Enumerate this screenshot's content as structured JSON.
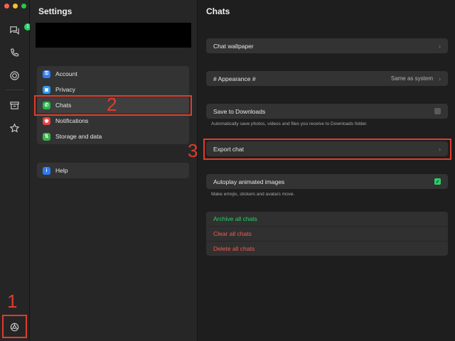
{
  "window": {
    "traffic_lights": [
      {
        "name": "close",
        "color": "#fe5f57"
      },
      {
        "name": "minimize",
        "color": "#febc2e"
      },
      {
        "name": "zoom",
        "color": "#28c840"
      }
    ]
  },
  "rail": {
    "chats_badge": "1",
    "badge_color": "#25d366",
    "icons": [
      "chats-icon",
      "calls-icon",
      "status-icon",
      "archive-icon",
      "starred-icon",
      "settings-icon"
    ]
  },
  "settings": {
    "title": "Settings",
    "items": [
      {
        "label": "Account",
        "icon": "key-icon",
        "color": "#2f7bf5",
        "glyph": "⚿"
      },
      {
        "label": "Privacy",
        "icon": "lock-icon",
        "color": "#2f9bf5",
        "glyph": "🔒"
      },
      {
        "label": "Chats",
        "icon": "chat-bubble-icon",
        "color": "#25b84c",
        "glyph": "✆"
      },
      {
        "label": "Notifications",
        "icon": "bell-icon",
        "color": "#e8423f",
        "glyph": "◉"
      },
      {
        "label": "Storage and data",
        "icon": "storage-icon",
        "color": "#3cb54a",
        "glyph": "⇅"
      }
    ],
    "help": {
      "label": "Help",
      "icon": "info-icon",
      "color": "#2f7bf5",
      "glyph": "i"
    }
  },
  "chats": {
    "title": "Chats",
    "wallpaper": {
      "label": "Chat wallpaper"
    },
    "appearance": {
      "label": "# Appearance #",
      "value": "Same as system"
    },
    "save_downloads": {
      "label": "Save to Downloads",
      "checked": false,
      "description": "Automatically save photos, videos and files you receive to Downloads folder."
    },
    "export": {
      "label": "Export chat"
    },
    "autoplay": {
      "label": "Autoplay animated images",
      "checked": true,
      "check_color": "#25d366",
      "description": "Make emojis, stickers and avatars move."
    },
    "actions": [
      {
        "label": "Archive all chats",
        "color": "#25d366"
      },
      {
        "label": "Clear all chats",
        "color": "#f15c4f"
      },
      {
        "label": "Delete all chats",
        "color": "#f15c4f"
      }
    ]
  },
  "annotations": {
    "color": "#e03c2b",
    "items": [
      {
        "number": "1",
        "target": "settings-icon"
      },
      {
        "number": "2",
        "target": "Chats"
      },
      {
        "number": "3",
        "target": "Export chat"
      }
    ]
  }
}
